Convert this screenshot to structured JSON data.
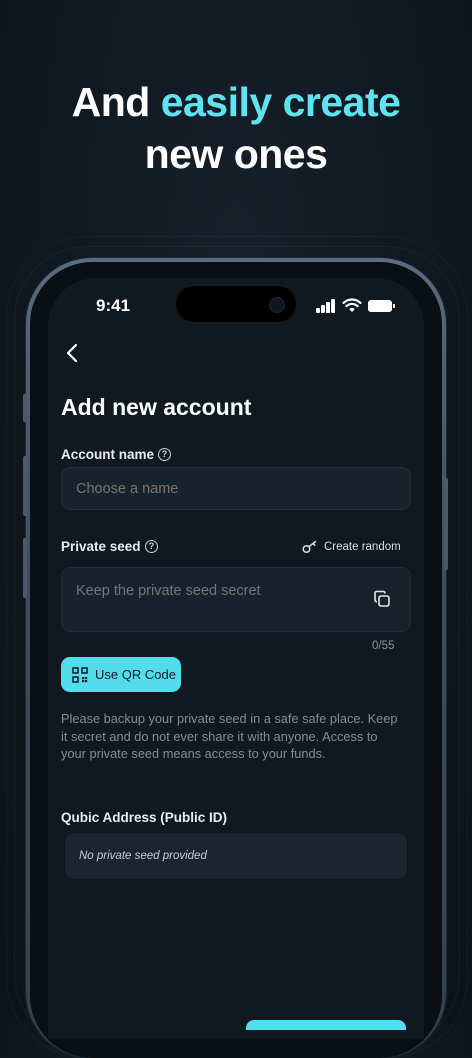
{
  "headline": {
    "line1_plain": "And",
    "line1_accent": "easily create",
    "line2": "new ones"
  },
  "status_bar": {
    "time": "9:41"
  },
  "page": {
    "title": "Add new account"
  },
  "account_name": {
    "label": "Account name",
    "placeholder": "Choose a name",
    "help_icon": "?"
  },
  "private_seed": {
    "label": "Private seed",
    "help_icon": "?",
    "create_random_label": "Create random",
    "placeholder": "Keep the private seed secret",
    "counter": "0/55"
  },
  "qr_button": {
    "label": "Use QR Code"
  },
  "backup_note": "Please backup your private seed in a safe safe place. Keep it secret and do not ever share it with anyone. Access to your private seed means access to your funds.",
  "public_id": {
    "label": "Qubic Address (Public ID)",
    "value": "No private seed provided"
  },
  "colors": {
    "accent": "#5fe3f0",
    "button": "#52dcec",
    "background": "#111920"
  }
}
